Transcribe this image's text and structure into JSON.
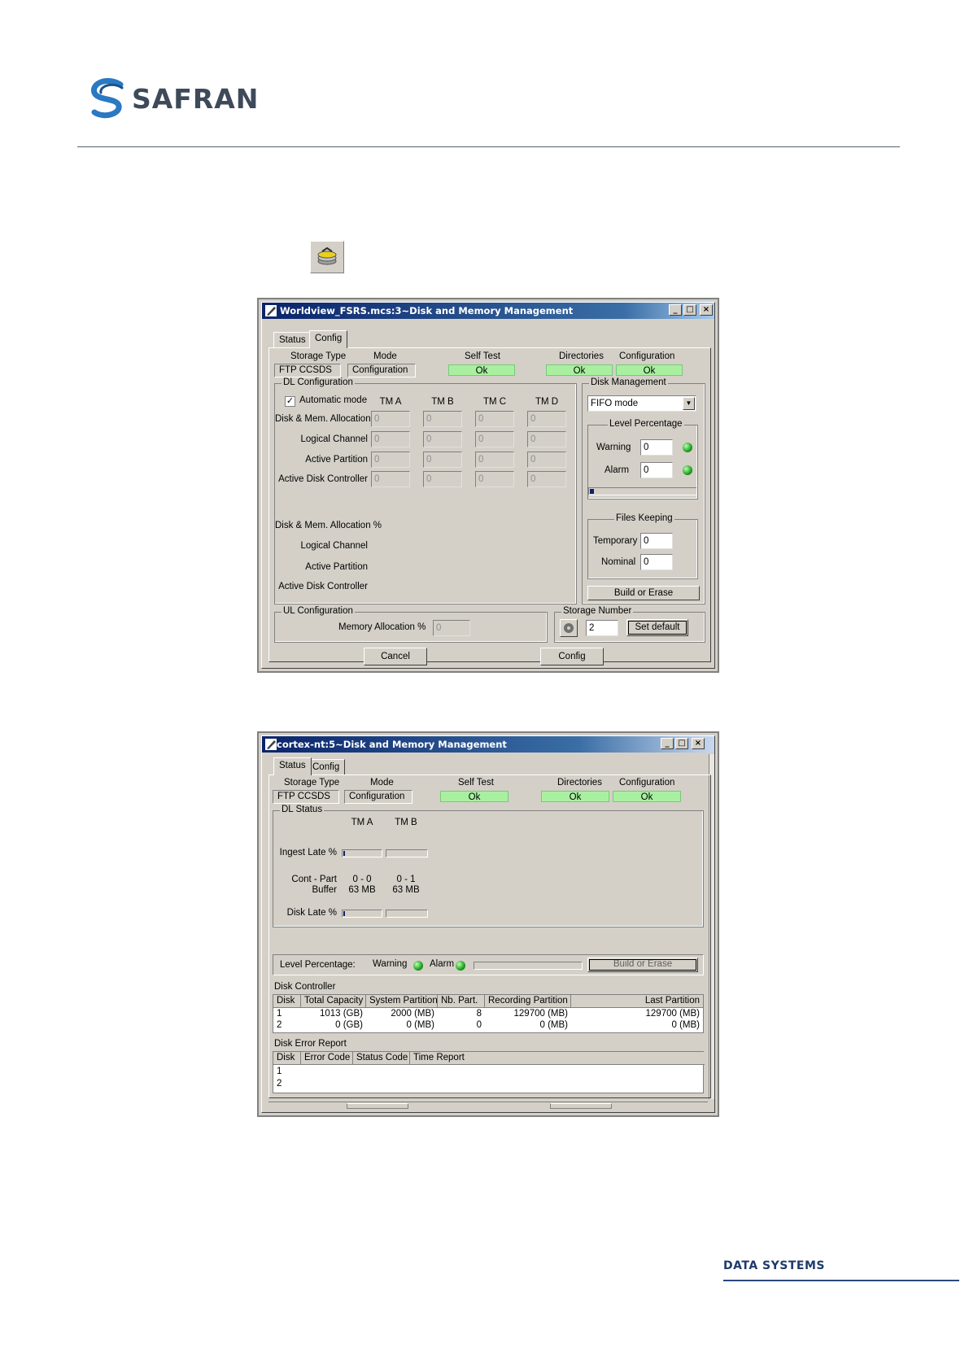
{
  "header": {
    "brand": "SAFRAN"
  },
  "footer": {
    "division": "DATA SYSTEMS"
  },
  "window_config": {
    "title": "Worldview_FSRS.mcs:3~Disk and Memory Management",
    "tabs": [
      {
        "label": "Status"
      },
      {
        "label": "Config"
      }
    ],
    "status_row": {
      "storage_type_label": "Storage Type",
      "storage_type_value": "FTP CCSDS",
      "mode_label": "Mode",
      "mode_value": "Configuration",
      "self_test_label": "Self Test",
      "self_test_value": "Ok",
      "directories_label": "Directories",
      "directories_value": "Ok",
      "configuration_label": "Configuration",
      "configuration_value": "Ok"
    },
    "dl_config": {
      "title": "DL Configuration",
      "automatic_mode": "Automatic mode",
      "columns": [
        "TM A",
        "TM B",
        "TM C",
        "TM D"
      ],
      "rows": [
        "Disk & Mem. Allocation %",
        "Logical Channel",
        "Active Partition",
        "Active Disk Controller"
      ],
      "value": "0",
      "rows2": [
        "Disk & Mem. Allocation %",
        "Logical Channel",
        "Active Partition",
        "Active Disk Controller"
      ]
    },
    "disk_mgmt": {
      "title": "Disk Management",
      "mode_select": "FIFO mode",
      "level_title": "Level Percentage",
      "warning_label": "Warning",
      "warning_value": "0",
      "alarm_label": "Alarm",
      "alarm_value": "0",
      "files_title": "Files Keeping",
      "temporary_label": "Temporary",
      "temporary_value": "0",
      "nominal_label": "Nominal",
      "nominal_value": "0",
      "build_button": "Build or Erase"
    },
    "ul_config": {
      "title": "UL Configuration",
      "memory_label": "Memory Allocation %",
      "memory_value": "0"
    },
    "storage_number": {
      "title": "Storage Number",
      "value": "2",
      "set_default": "Set default"
    },
    "buttons": {
      "cancel": "Cancel",
      "config": "Config"
    }
  },
  "window_status": {
    "title": "cortex-nt:5~Disk and Memory Management",
    "tabs": [
      {
        "label": "Status"
      },
      {
        "label": "Config"
      }
    ],
    "status_row": {
      "storage_type_label": "Storage Type",
      "storage_type_value": "FTP CCSDS",
      "mode_label": "Mode",
      "mode_value": "Configuration",
      "self_test_label": "Self Test",
      "self_test_value": "Ok",
      "directories_label": "Directories",
      "directories_value": "Ok",
      "configuration_label": "Configuration",
      "configuration_value": "Ok"
    },
    "dl_status": {
      "title": "DL Status",
      "columns": [
        "TM A",
        "TM B"
      ],
      "ingest_label": "Ingest Late %",
      "cont_part_label": "Cont - Part",
      "buffer_label": "Buffer",
      "cont_part_values": [
        "0 - 0",
        "0 - 1"
      ],
      "buffer_values": [
        "63 MB",
        "63 MB"
      ],
      "disk_late_label": "Disk Late %"
    },
    "level": {
      "label": "Level Percentage:",
      "warning": "Warning",
      "alarm": "Alarm",
      "build_button": "Build or Erase"
    },
    "disk_controller": {
      "title": "Disk Controller",
      "headers": [
        "Disk",
        "Total Capacity",
        "System Partition",
        "Nb. Part.",
        "Recording Partition",
        "Last Partition"
      ],
      "rows": [
        [
          "1",
          "1013 (GB)",
          "2000 (MB)",
          "8",
          "129700 (MB)",
          "129700 (MB)"
        ],
        [
          "2",
          "0 (GB)",
          "0 (MB)",
          "0",
          "0 (MB)",
          "0 (MB)"
        ]
      ]
    },
    "disk_error": {
      "title": "Disk Error Report",
      "headers": [
        "Disk",
        "Error Code",
        "Status Code",
        "Time Report"
      ],
      "rows": [
        [
          "1"
        ],
        [
          "2"
        ]
      ]
    }
  },
  "colors": {
    "face": "#d4d0c8",
    "ok_green": "#a8f0a0",
    "title_blue": "#0a246a",
    "led_green": "#1ea01e"
  }
}
